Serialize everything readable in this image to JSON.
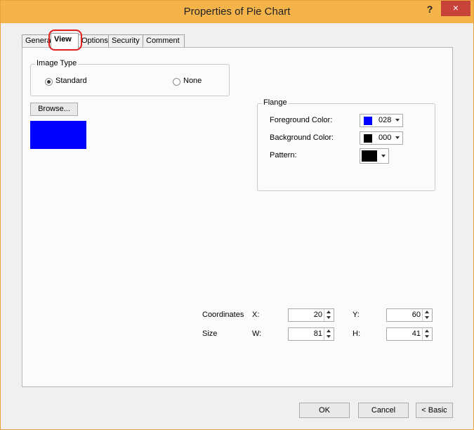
{
  "window": {
    "title": "Properties of Pie Chart",
    "help": "?",
    "close": "×"
  },
  "tabs": [
    {
      "label": "General"
    },
    {
      "label": "View"
    },
    {
      "label": "Options"
    },
    {
      "label": "Security"
    },
    {
      "label": "Comment"
    }
  ],
  "image_type": {
    "group_label": "Image Type",
    "standard": "Standard",
    "none": "None",
    "selected": "Standard"
  },
  "browse_label": "Browse...",
  "preview_color": "#0000ff",
  "flange": {
    "group_label": "Flange",
    "fg_label": "Foreground Color:",
    "fg_value": "028",
    "fg_color": "#0000ff",
    "bg_label": "Background Color:",
    "bg_value": "000",
    "bg_color": "#000000",
    "pattern_label": "Pattern:",
    "pattern_color": "#000000"
  },
  "coords": {
    "coords_label": "Coordinates",
    "x_label": "X:",
    "x_value": "20",
    "y_label": "Y:",
    "y_value": "60",
    "size_label": "Size",
    "w_label": "W:",
    "w_value": "81",
    "h_label": "H:",
    "h_value": "41"
  },
  "footer": {
    "ok": "OK",
    "cancel": "Cancel",
    "basic": "< Basic"
  },
  "highlight_color": "#e02020"
}
